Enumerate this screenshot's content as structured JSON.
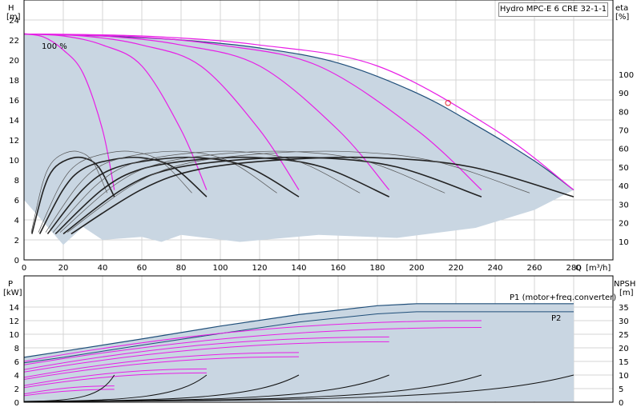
{
  "chart_data": [
    {
      "type": "line",
      "panel": "head-efficiency",
      "title": "Hydro MPC-E 6 CRE 32-1-1",
      "ylabel": "H",
      "yunit": "[m]",
      "y2label": "eta",
      "y2unit": "[%]",
      "xlabel": "Q",
      "xunit": "[m³/h]",
      "xlim": [
        0,
        300
      ],
      "ylim": [
        0,
        26
      ],
      "y2lim": [
        0,
        100
      ],
      "x_ticks": [
        0,
        20,
        40,
        60,
        80,
        100,
        120,
        140,
        160,
        180,
        200,
        220,
        240,
        260,
        280
      ],
      "y_ticks": [
        0,
        2,
        4,
        6,
        8,
        10,
        12,
        14,
        16,
        18,
        20,
        22,
        24
      ],
      "y2_ticks": [
        10,
        20,
        30,
        40,
        50,
        60,
        70,
        80,
        90,
        100
      ],
      "annotation": "100 %",
      "grid": true,
      "operating_point": {
        "x": 216,
        "y": 15.7
      },
      "envelope_top": [
        [
          0,
          22.6
        ],
        [
          40,
          22.4
        ],
        [
          80,
          22.0
        ],
        [
          120,
          21.2
        ],
        [
          160,
          19.7
        ],
        [
          200,
          16.7
        ],
        [
          230,
          13.5
        ],
        [
          260,
          9.9
        ],
        [
          280,
          7.0
        ]
      ],
      "envelope_bottom": [
        [
          0,
          6.0
        ],
        [
          20,
          1.5
        ],
        [
          30,
          3.3
        ],
        [
          40,
          2.0
        ],
        [
          60,
          2.3
        ],
        [
          70,
          1.8
        ],
        [
          80,
          2.5
        ],
        [
          110,
          1.8
        ],
        [
          150,
          2.5
        ],
        [
          190,
          2.2
        ],
        [
          230,
          3.2
        ],
        [
          260,
          5.0
        ],
        [
          280,
          7.0
        ]
      ],
      "head_curves": [
        {
          "pumps": 1,
          "points": [
            [
              0,
              22.6
            ],
            [
              10,
              22.3
            ],
            [
              20,
              21.0
            ],
            [
              30,
              18.7
            ],
            [
              40,
              13.0
            ],
            [
              46,
              7.0
            ]
          ]
        },
        {
          "pumps": 2,
          "points": [
            [
              0,
              22.6
            ],
            [
              20,
              22.4
            ],
            [
              40,
              21.5
            ],
            [
              60,
              19.4
            ],
            [
              80,
              13.0
            ],
            [
              93,
              7.0
            ]
          ]
        },
        {
          "pumps": 3,
          "points": [
            [
              0,
              22.6
            ],
            [
              30,
              22.4
            ],
            [
              60,
              21.5
            ],
            [
              90,
              19.4
            ],
            [
              120,
              13.0
            ],
            [
              140,
              7.0
            ]
          ]
        },
        {
          "pumps": 4,
          "points": [
            [
              0,
              22.6
            ],
            [
              40,
              22.4
            ],
            [
              80,
              21.5
            ],
            [
              120,
              19.4
            ],
            [
              160,
              13.0
            ],
            [
              186,
              7.0
            ]
          ]
        },
        {
          "pumps": 5,
          "points": [
            [
              0,
              22.6
            ],
            [
              50,
              22.4
            ],
            [
              100,
              21.5
            ],
            [
              150,
              19.4
            ],
            [
              200,
              13.0
            ],
            [
              233,
              7.0
            ]
          ]
        },
        {
          "pumps": 6,
          "points": [
            [
              0,
              22.6
            ],
            [
              60,
              22.4
            ],
            [
              120,
              21.5
            ],
            [
              180,
              19.4
            ],
            [
              240,
              13.0
            ],
            [
              280,
              7.0
            ]
          ]
        }
      ],
      "efficiency_curves": [
        {
          "pumps": 1,
          "points": [
            [
              4,
              14
            ],
            [
              10,
              38
            ],
            [
              15,
              49
            ],
            [
              22,
              54
            ],
            [
              30,
              55
            ],
            [
              38,
              50
            ],
            [
              46,
              34
            ]
          ]
        },
        {
          "pumps": 2,
          "points": [
            [
              8,
              14
            ],
            [
              20,
              38
            ],
            [
              30,
              49
            ],
            [
              45,
              54
            ],
            [
              60,
              55
            ],
            [
              76,
              50
            ],
            [
              93,
              34
            ]
          ]
        },
        {
          "pumps": 3,
          "points": [
            [
              12,
              14
            ],
            [
              30,
              38
            ],
            [
              45,
              49
            ],
            [
              67,
              54
            ],
            [
              90,
              55
            ],
            [
              114,
              50
            ],
            [
              140,
              34
            ]
          ]
        },
        {
          "pumps": 4,
          "points": [
            [
              16,
              14
            ],
            [
              40,
              38
            ],
            [
              60,
              49
            ],
            [
              89,
              54
            ],
            [
              120,
              55
            ],
            [
              152,
              50
            ],
            [
              186,
              34
            ]
          ]
        },
        {
          "pumps": 5,
          "points": [
            [
              20,
              14
            ],
            [
              50,
              38
            ],
            [
              75,
              49
            ],
            [
              111,
              54
            ],
            [
              150,
              55
            ],
            [
              190,
              50
            ],
            [
              233,
              34
            ]
          ]
        },
        {
          "pumps": 6,
          "points": [
            [
              24,
              14
            ],
            [
              60,
              38
            ],
            [
              90,
              49
            ],
            [
              133,
              54
            ],
            [
              180,
              55
            ],
            [
              228,
              50
            ],
            [
              280,
              34
            ]
          ]
        }
      ]
    },
    {
      "type": "line",
      "panel": "power-npsh",
      "ylabel": "P",
      "yunit": "[kW]",
      "y2label": "NPSH",
      "y2unit": "[m]",
      "xlim": [
        0,
        300
      ],
      "ylim": [
        0,
        16
      ],
      "y2lim": [
        0,
        40
      ],
      "y_ticks": [
        0,
        2,
        4,
        6,
        8,
        10,
        12,
        14
      ],
      "y2_ticks": [
        0,
        5,
        10,
        15,
        20,
        25,
        30,
        35
      ],
      "grid": true,
      "series_labels": [
        "P1 (motor+freq.converter)",
        "P2"
      ],
      "p1_line": [
        [
          0,
          6.6
        ],
        [
          20,
          7.5
        ],
        [
          60,
          9.3
        ],
        [
          100,
          11.2
        ],
        [
          140,
          12.9
        ],
        [
          180,
          14.2
        ],
        [
          200,
          14.5
        ],
        [
          280,
          14.5
        ]
      ],
      "p2_line": [
        [
          0,
          5.8
        ],
        [
          20,
          6.6
        ],
        [
          60,
          8.4
        ],
        [
          100,
          10.1
        ],
        [
          140,
          11.8
        ],
        [
          180,
          13.0
        ],
        [
          200,
          13.3
        ],
        [
          280,
          13.3
        ]
      ],
      "envelope_top": [
        [
          0,
          6.6
        ],
        [
          20,
          7.5
        ],
        [
          60,
          9.3
        ],
        [
          100,
          11.2
        ],
        [
          140,
          12.9
        ],
        [
          180,
          14.2
        ],
        [
          200,
          14.5
        ],
        [
          280,
          14.5
        ]
      ],
      "envelope_bottom": [
        [
          0,
          0.1
        ],
        [
          280,
          0.1
        ]
      ],
      "power_lines": [
        {
          "pumps": 1,
          "y": [
            1.9,
            2.4
          ],
          "xmax": 46
        },
        {
          "pumps": 2,
          "y": [
            4.3,
            4.9
          ],
          "xmax": 93
        },
        {
          "pumps": 3,
          "y": [
            6.7,
            7.3
          ],
          "xmax": 140
        },
        {
          "pumps": 4,
          "y": [
            8.9,
            9.6
          ],
          "xmax": 186
        },
        {
          "pumps": 5,
          "y": [
            11.0,
            12.0
          ],
          "xmax": 233
        }
      ],
      "npsh_curves": [
        {
          "pumps": 1,
          "xmax": 46,
          "ymax": 10
        },
        {
          "pumps": 2,
          "xmax": 93,
          "ymax": 10
        },
        {
          "pumps": 3,
          "xmax": 140,
          "ymax": 10
        },
        {
          "pumps": 4,
          "xmax": 186,
          "ymax": 10
        },
        {
          "pumps": 5,
          "xmax": 233,
          "ymax": 10
        },
        {
          "pumps": 6,
          "xmax": 280,
          "ymax": 10
        }
      ]
    }
  ],
  "colors": {
    "fill": "#c9d6e2",
    "envelope": "#1f4e79",
    "head": "#e81fe6",
    "power": "#e81fe6",
    "efficiency": "#000000",
    "grid": "#d4d4d4",
    "marker": "#e03030"
  }
}
